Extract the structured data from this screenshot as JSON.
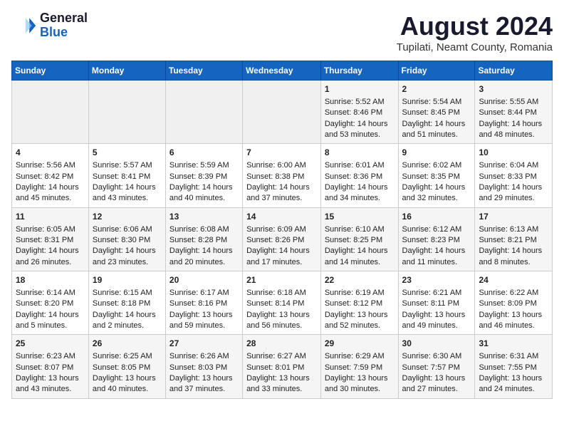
{
  "logo": {
    "general": "General",
    "blue": "Blue"
  },
  "title": "August 2024",
  "subtitle": "Tupilati, Neamt County, Romania",
  "days": [
    "Sunday",
    "Monday",
    "Tuesday",
    "Wednesday",
    "Thursday",
    "Friday",
    "Saturday"
  ],
  "weeks": [
    [
      {
        "day": "",
        "content": ""
      },
      {
        "day": "",
        "content": ""
      },
      {
        "day": "",
        "content": ""
      },
      {
        "day": "",
        "content": ""
      },
      {
        "day": "1",
        "content": "Sunrise: 5:52 AM\nSunset: 8:46 PM\nDaylight: 14 hours\nand 53 minutes."
      },
      {
        "day": "2",
        "content": "Sunrise: 5:54 AM\nSunset: 8:45 PM\nDaylight: 14 hours\nand 51 minutes."
      },
      {
        "day": "3",
        "content": "Sunrise: 5:55 AM\nSunset: 8:44 PM\nDaylight: 14 hours\nand 48 minutes."
      }
    ],
    [
      {
        "day": "4",
        "content": "Sunrise: 5:56 AM\nSunset: 8:42 PM\nDaylight: 14 hours\nand 45 minutes."
      },
      {
        "day": "5",
        "content": "Sunrise: 5:57 AM\nSunset: 8:41 PM\nDaylight: 14 hours\nand 43 minutes."
      },
      {
        "day": "6",
        "content": "Sunrise: 5:59 AM\nSunset: 8:39 PM\nDaylight: 14 hours\nand 40 minutes."
      },
      {
        "day": "7",
        "content": "Sunrise: 6:00 AM\nSunset: 8:38 PM\nDaylight: 14 hours\nand 37 minutes."
      },
      {
        "day": "8",
        "content": "Sunrise: 6:01 AM\nSunset: 8:36 PM\nDaylight: 14 hours\nand 34 minutes."
      },
      {
        "day": "9",
        "content": "Sunrise: 6:02 AM\nSunset: 8:35 PM\nDaylight: 14 hours\nand 32 minutes."
      },
      {
        "day": "10",
        "content": "Sunrise: 6:04 AM\nSunset: 8:33 PM\nDaylight: 14 hours\nand 29 minutes."
      }
    ],
    [
      {
        "day": "11",
        "content": "Sunrise: 6:05 AM\nSunset: 8:31 PM\nDaylight: 14 hours\nand 26 minutes."
      },
      {
        "day": "12",
        "content": "Sunrise: 6:06 AM\nSunset: 8:30 PM\nDaylight: 14 hours\nand 23 minutes."
      },
      {
        "day": "13",
        "content": "Sunrise: 6:08 AM\nSunset: 8:28 PM\nDaylight: 14 hours\nand 20 minutes."
      },
      {
        "day": "14",
        "content": "Sunrise: 6:09 AM\nSunset: 8:26 PM\nDaylight: 14 hours\nand 17 minutes."
      },
      {
        "day": "15",
        "content": "Sunrise: 6:10 AM\nSunset: 8:25 PM\nDaylight: 14 hours\nand 14 minutes."
      },
      {
        "day": "16",
        "content": "Sunrise: 6:12 AM\nSunset: 8:23 PM\nDaylight: 14 hours\nand 11 minutes."
      },
      {
        "day": "17",
        "content": "Sunrise: 6:13 AM\nSunset: 8:21 PM\nDaylight: 14 hours\nand 8 minutes."
      }
    ],
    [
      {
        "day": "18",
        "content": "Sunrise: 6:14 AM\nSunset: 8:20 PM\nDaylight: 14 hours\nand 5 minutes."
      },
      {
        "day": "19",
        "content": "Sunrise: 6:15 AM\nSunset: 8:18 PM\nDaylight: 14 hours\nand 2 minutes."
      },
      {
        "day": "20",
        "content": "Sunrise: 6:17 AM\nSunset: 8:16 PM\nDaylight: 13 hours\nand 59 minutes."
      },
      {
        "day": "21",
        "content": "Sunrise: 6:18 AM\nSunset: 8:14 PM\nDaylight: 13 hours\nand 56 minutes."
      },
      {
        "day": "22",
        "content": "Sunrise: 6:19 AM\nSunset: 8:12 PM\nDaylight: 13 hours\nand 52 minutes."
      },
      {
        "day": "23",
        "content": "Sunrise: 6:21 AM\nSunset: 8:11 PM\nDaylight: 13 hours\nand 49 minutes."
      },
      {
        "day": "24",
        "content": "Sunrise: 6:22 AM\nSunset: 8:09 PM\nDaylight: 13 hours\nand 46 minutes."
      }
    ],
    [
      {
        "day": "25",
        "content": "Sunrise: 6:23 AM\nSunset: 8:07 PM\nDaylight: 13 hours\nand 43 minutes."
      },
      {
        "day": "26",
        "content": "Sunrise: 6:25 AM\nSunset: 8:05 PM\nDaylight: 13 hours\nand 40 minutes."
      },
      {
        "day": "27",
        "content": "Sunrise: 6:26 AM\nSunset: 8:03 PM\nDaylight: 13 hours\nand 37 minutes."
      },
      {
        "day": "28",
        "content": "Sunrise: 6:27 AM\nSunset: 8:01 PM\nDaylight: 13 hours\nand 33 minutes."
      },
      {
        "day": "29",
        "content": "Sunrise: 6:29 AM\nSunset: 7:59 PM\nDaylight: 13 hours\nand 30 minutes."
      },
      {
        "day": "30",
        "content": "Sunrise: 6:30 AM\nSunset: 7:57 PM\nDaylight: 13 hours\nand 27 minutes."
      },
      {
        "day": "31",
        "content": "Sunrise: 6:31 AM\nSunset: 7:55 PM\nDaylight: 13 hours\nand 24 minutes."
      }
    ]
  ]
}
